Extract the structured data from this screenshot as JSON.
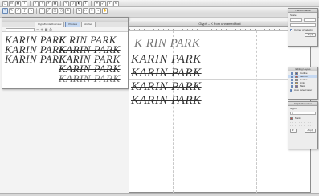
{
  "toolbar_top": {
    "icons": [
      "new-file-icon",
      "open-file-icon",
      "save-icon",
      "info-icon",
      "back-icon",
      "forward-icon",
      "zoom-icon",
      "grid-icon",
      "pen-icon",
      "shape-icon",
      "fill-icon",
      "text-icon",
      "layer-icon",
      "transform-icon",
      "export-icon",
      "settings-icon"
    ]
  },
  "toolbar_tools": {
    "icons": [
      "pointer-icon",
      "pen-icon",
      "pencil-icon",
      "brush-icon",
      "curve-icon",
      "node-icon",
      "line-icon",
      "rectangle-icon",
      "ellipse-icon",
      "rotate-icon",
      "scale-icon",
      "measure-icon",
      "knife-icon",
      "zoom-icon",
      "hand-icon"
    ]
  },
  "font_window": {
    "tabs": [
      "Glyph/Fonts Overview",
      "Preview",
      "Archive"
    ],
    "active_tab": "Preview",
    "specimen": "KARIN PARK",
    "partial_specimen": "K  RIN PARK"
  },
  "glyph_window": {
    "title": "Glyph – K from unnamed font",
    "partial_specimen": "K  RIN PARK",
    "specimen": "KARIN PARK"
  },
  "transformation_panel": {
    "title": "Transformation",
    "scale_label": "Scale",
    "corner_label": "Corner of selectn",
    "apply": "Apply"
  },
  "layers_panel": {
    "title": "Editing Layers",
    "items": [
      {
        "label": "Outline",
        "color": "#2f58c8",
        "checked": true,
        "selected": false
      },
      {
        "label": "Metrics",
        "color": "#e03c3c",
        "checked": true,
        "selected": true
      },
      {
        "label": "Guides",
        "color": "#2fa84a",
        "checked": true,
        "selected": false
      },
      {
        "label": "Hints",
        "color": "#e0a22f",
        "checked": false,
        "selected": false
      },
      {
        "label": "Mask",
        "color": "#7a4ac8",
        "checked": false,
        "selected": false
      }
    ],
    "auto_select": "Auto select layer"
  },
  "glyph_properties_panel": {
    "title": "Glyph Properties",
    "name_label": "Glyph",
    "name_value": "K",
    "mark_label": "Mark",
    "apply": "Apply"
  }
}
